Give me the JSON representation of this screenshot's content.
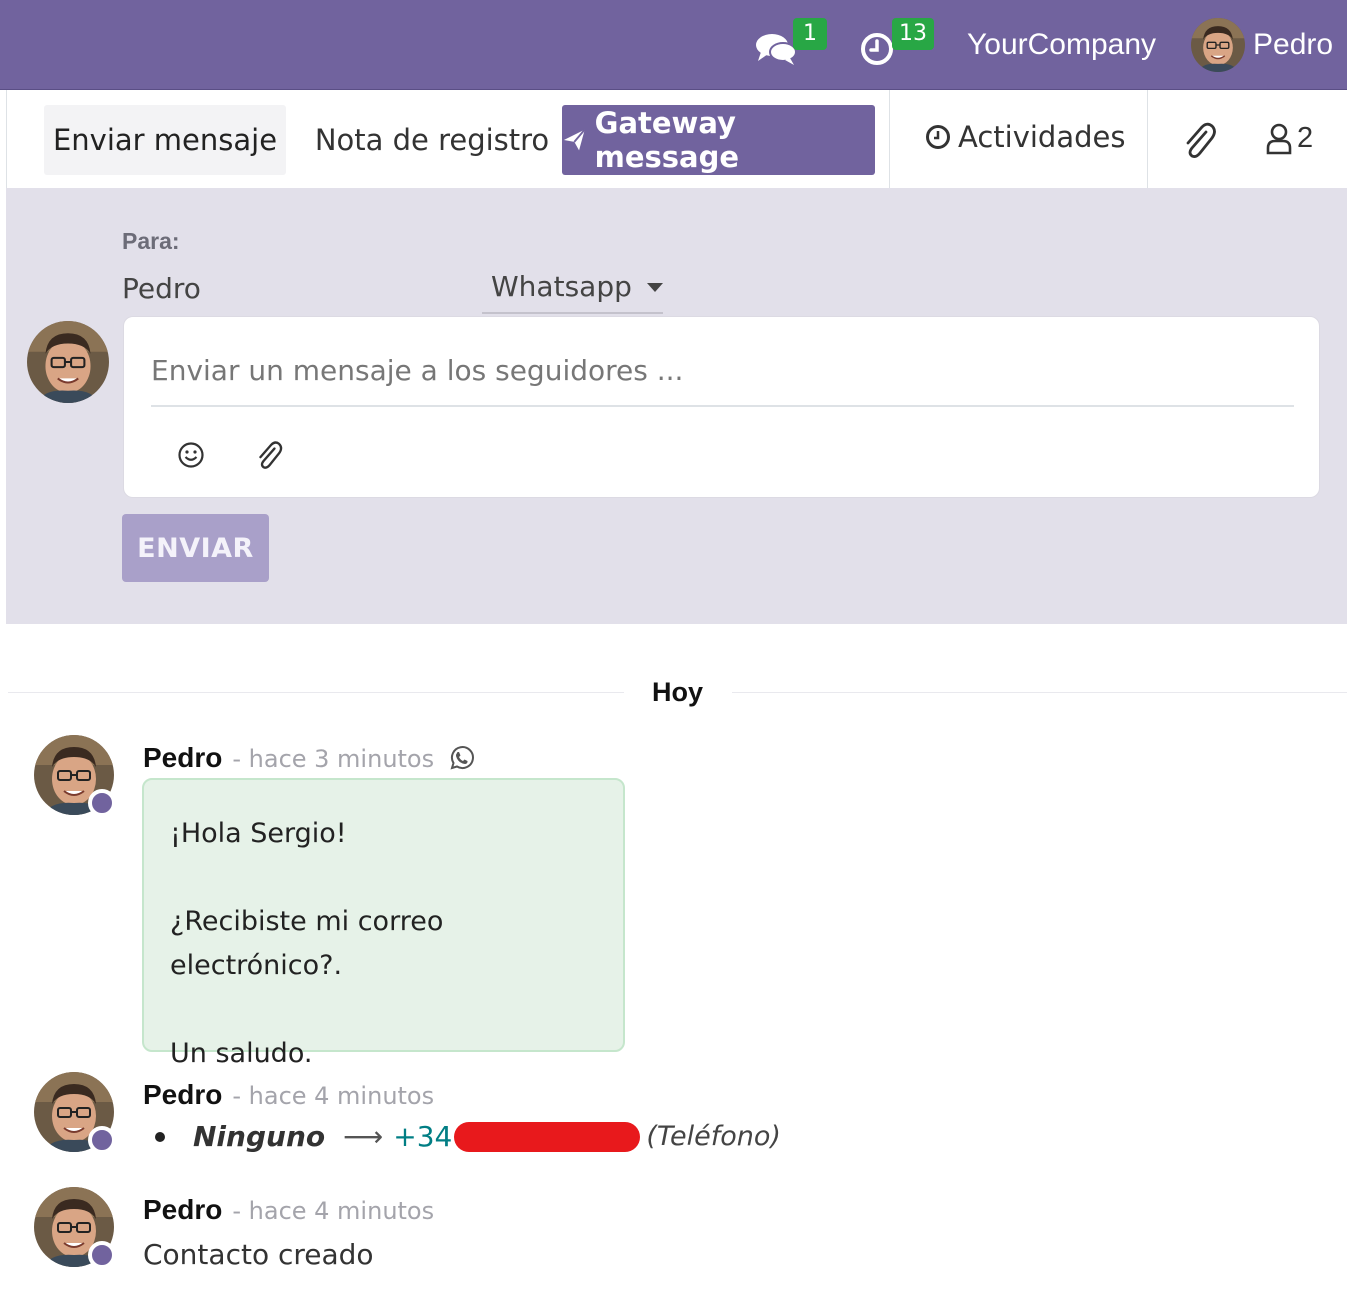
{
  "navbar": {
    "messages_badge": "1",
    "activities_badge": "13",
    "company": "YourCompany",
    "user_name": "Pedro"
  },
  "chatter_tabs": {
    "send_message": "Enviar mensaje",
    "log_note": "Nota de registro",
    "gateway_message": "Gateway message",
    "activities": "Actividades",
    "followers_count": "2"
  },
  "composer": {
    "to_label": "Para:",
    "recipient": "Pedro",
    "channel": "Whatsapp",
    "placeholder": "Enviar un mensaje a los seguidores ...",
    "send_label": "ENVIAR"
  },
  "thread": {
    "day_label": "Hoy",
    "messages": [
      {
        "author": "Pedro",
        "date": "- hace 3 minutos",
        "lines": [
          "¡Hola Sergio!",
          "¿Recibiste mi correo electrónico?.",
          "Un saludo."
        ]
      },
      {
        "author": "Pedro",
        "date": "- hace 4 minutos",
        "tracking": {
          "old_value": "Ninguno",
          "new_value": "+34",
          "field": "(Teléfono)"
        }
      },
      {
        "author": "Pedro",
        "date": "- hace 4 minutos",
        "body": "Contacto creado"
      }
    ]
  },
  "colors": {
    "brand": "#71639e",
    "badge": "#28a745",
    "bubble": "#e6f2e8",
    "link": "#017e84",
    "redaction": "#e8191c"
  },
  "icons": [
    "comments-icon",
    "clock-icon",
    "paper-plane-icon",
    "paperclip-icon",
    "user-icon",
    "smiley-icon",
    "whatsapp-icon",
    "arrow-right-icon"
  ]
}
